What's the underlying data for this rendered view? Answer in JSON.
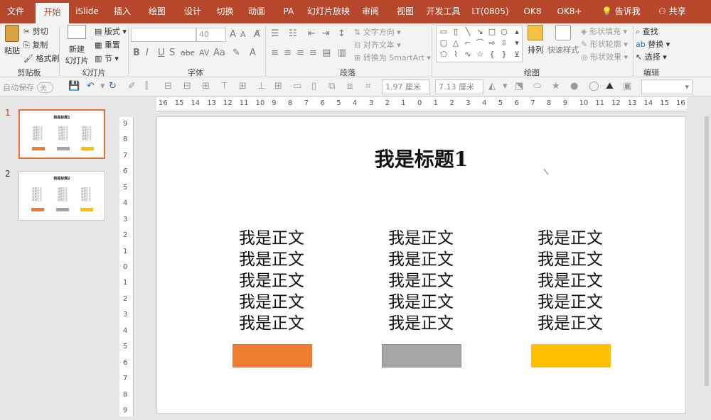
{
  "tabs": [
    {
      "label": "文件",
      "active": false
    },
    {
      "label": "开始",
      "active": true
    },
    {
      "label": "iSlide",
      "active": false
    },
    {
      "label": "插入",
      "active": false
    },
    {
      "label": "绘图",
      "active": false
    },
    {
      "label": "设计",
      "active": false
    },
    {
      "label": "切换",
      "active": false
    },
    {
      "label": "动画",
      "active": false
    },
    {
      "label": "PA",
      "active": false
    },
    {
      "label": "幻灯片放映",
      "active": false
    },
    {
      "label": "审阅",
      "active": false
    },
    {
      "label": "视图",
      "active": false
    },
    {
      "label": "开发工具",
      "active": false
    },
    {
      "label": "LT(0805)",
      "active": false
    },
    {
      "label": "OK8",
      "active": false
    },
    {
      "label": "OK8+",
      "active": false
    }
  ],
  "tell_me": "告诉我",
  "share": "共享",
  "ribbon": {
    "clipboard": {
      "paste": "粘贴",
      "cut": "剪切",
      "copy": "复制",
      "format_painter": "格式刷",
      "label": "剪贴板"
    },
    "slides": {
      "new_slide": "新建",
      "new_slide_2": "幻灯片",
      "layout": "版式",
      "reset": "重置",
      "section": "节",
      "label": "幻灯片"
    },
    "font": {
      "font_size": "40",
      "label": "字体"
    },
    "paragraph": {
      "text_direction": "文字方向",
      "align_text": "对齐文本",
      "convert_smartart": "转换为 SmartArt",
      "label": "段落"
    },
    "drawing": {
      "arrange": "排列",
      "quick_styles": "快速样式",
      "shape_fill": "形状填充",
      "shape_outline": "形状轮廓",
      "shape_effects": "形状效果",
      "label": "绘图"
    },
    "editing": {
      "find": "查找",
      "replace": "替换",
      "select": "选择",
      "label": "编辑"
    }
  },
  "qat": {
    "autosave": "自动保存",
    "autosave_state": "关",
    "height": "1.97 厘米",
    "width": "7.13 厘米"
  },
  "thumbnails": [
    {
      "num": "1",
      "title": "我是标题1",
      "selected": true
    },
    {
      "num": "2",
      "title": "我是标题2",
      "selected": false
    }
  ],
  "thumb_body": "我是正文\n我是正文\n我是正文\n我是正文\n我是正文",
  "hruler_ticks": [
    "16",
    "15",
    "14",
    "13",
    "12",
    "11",
    "10",
    "9",
    "8",
    "7",
    "6",
    "5",
    "4",
    "3",
    "2",
    "1",
    "0",
    "1",
    "2",
    "3",
    "4",
    "5",
    "6",
    "7",
    "8",
    "9",
    "10",
    "11",
    "12",
    "13",
    "14",
    "15",
    "16"
  ],
  "vruler_ticks": [
    "9",
    "8",
    "7",
    "6",
    "5",
    "4",
    "3",
    "2",
    "1",
    "0",
    "1",
    "2",
    "3",
    "4",
    "5",
    "6",
    "7",
    "8",
    "9"
  ],
  "slide": {
    "title": "我是标题1",
    "columns": [
      {
        "lines": [
          "我是正文",
          "我是正文",
          "我是正文",
          "我是正文",
          "我是正文"
        ]
      },
      {
        "lines": [
          "我是正文",
          "我是正文",
          "我是正文",
          "我是正文",
          "我是正文"
        ]
      },
      {
        "lines": [
          "我是正文",
          "我是正文",
          "我是正文",
          "我是正文",
          "我是正文"
        ]
      }
    ]
  },
  "colors": {
    "accent": "#b7472a",
    "bar_orange": "#ed7d31",
    "bar_gray": "#a5a5a5",
    "bar_gold": "#ffc000",
    "selected_border": "#e07437"
  }
}
